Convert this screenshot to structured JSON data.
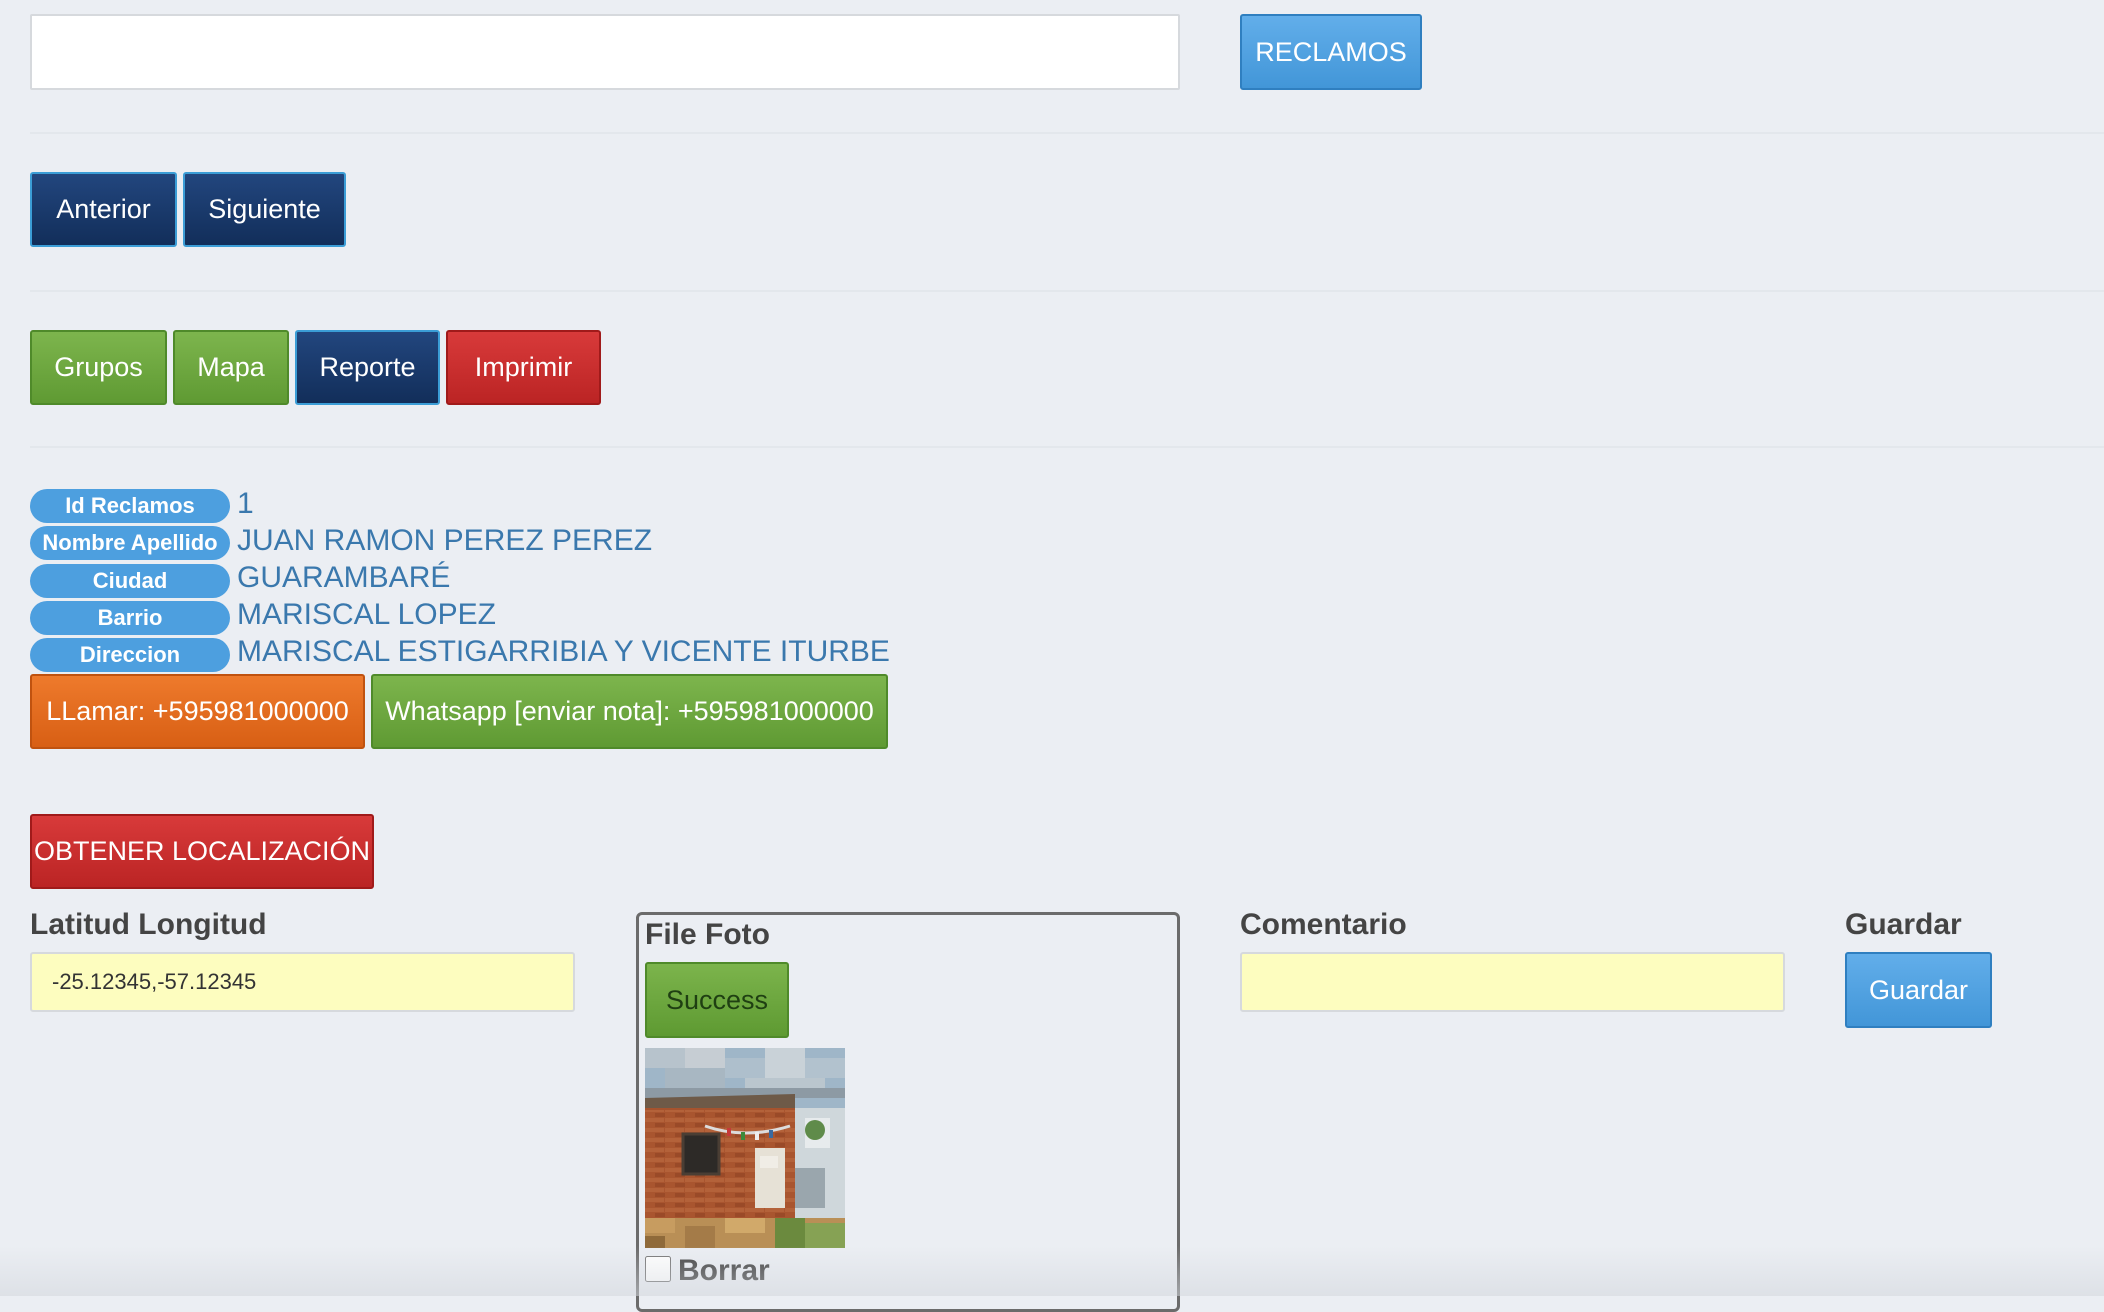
{
  "top": {
    "search_value": "",
    "reclamos_label": "RECLAMOS"
  },
  "nav": {
    "anterior_label": "Anterior",
    "siguiente_label": "Siguiente"
  },
  "actions": {
    "grupos_label": "Grupos",
    "mapa_label": "Mapa",
    "reporte_label": "Reporte",
    "imprimir_label": "Imprimir"
  },
  "record": {
    "fields": [
      {
        "label": "Id Reclamos",
        "value": "1"
      },
      {
        "label": "Nombre Apellido",
        "value": "JUAN RAMON PEREZ PEREZ"
      },
      {
        "label": "Ciudad",
        "value": "GUARAMBARÉ"
      },
      {
        "label": "Barrio",
        "value": "MARISCAL LOPEZ"
      },
      {
        "label": "Direccion",
        "value": "MARISCAL ESTIGARRIBIA Y VICENTE ITURBE"
      }
    ],
    "call_label": "LLamar: +595981000000",
    "whatsapp_label": "Whatsapp [enviar nota]: +595981000000"
  },
  "location": {
    "get_location_label": "OBTENER LOCALIZACIÓN",
    "latlng_title": "Latitud Longitud",
    "latlng_value": "-25.12345,-57.12345"
  },
  "photo": {
    "title": "File Foto",
    "success_label": "Success",
    "delete_label": "Borrar",
    "delete_checked": false
  },
  "comment": {
    "title": "Comentario",
    "value": ""
  },
  "save": {
    "title": "Guardar",
    "button_label": "Guardar"
  },
  "colors": {
    "background": "#ebeef3",
    "blue": "#4a9fe0",
    "navy": "#16335f",
    "green": "#6aa63d",
    "red": "#c82c2c",
    "orange": "#e26a1e",
    "value_text": "#3a78ad",
    "input_yellow": "#fdfdbf"
  }
}
